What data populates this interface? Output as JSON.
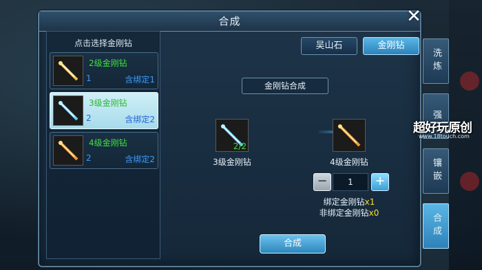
{
  "window": {
    "title": "合成",
    "close_icon": "close-icon"
  },
  "left_list": {
    "heading": "点击选择金刚钻",
    "items": [
      {
        "name": "2级金刚钻",
        "count": "1",
        "bound": "含绑定1",
        "selected": false,
        "icon": "drill-icon-gold"
      },
      {
        "name": "3级金刚钻",
        "count": "2",
        "bound": "含绑定2",
        "selected": true,
        "icon": "drill-icon-blue"
      },
      {
        "name": "4级金刚钻",
        "count": "2",
        "bound": "含绑定2",
        "selected": false,
        "icon": "drill-icon-orange"
      }
    ]
  },
  "tabs": {
    "wushanshi": "吴山石",
    "jingangzuan": "金刚钻"
  },
  "section_title": "金刚钻合成",
  "source": {
    "label": "3级金刚钻",
    "count": "2/2",
    "icon": "drill-icon-blue"
  },
  "target": {
    "label": "4级金刚钻",
    "icon": "drill-icon-orange"
  },
  "quantity": {
    "value": "1",
    "minus_icon": "minus-icon",
    "plus_icon": "plus-icon"
  },
  "info": {
    "bound_label": "绑定金刚钻",
    "bound_qty": "x1",
    "unbound_label": "非绑定金刚钻",
    "unbound_qty": "x0"
  },
  "compose_button": "合成",
  "side_tabs": [
    {
      "label": "洗炼",
      "active": false
    },
    {
      "label": "强",
      "active": false
    },
    {
      "label": "镶嵌",
      "active": false
    },
    {
      "label": "合成",
      "active": true
    }
  ],
  "watermark": {
    "text": "超好玩原创",
    "url": "www.18touch.com"
  },
  "colors": {
    "accent": "#2d82b9",
    "green_text": "#3fe03f",
    "blue_text": "#3b9bff",
    "yellow_text": "#ffdc2e"
  }
}
